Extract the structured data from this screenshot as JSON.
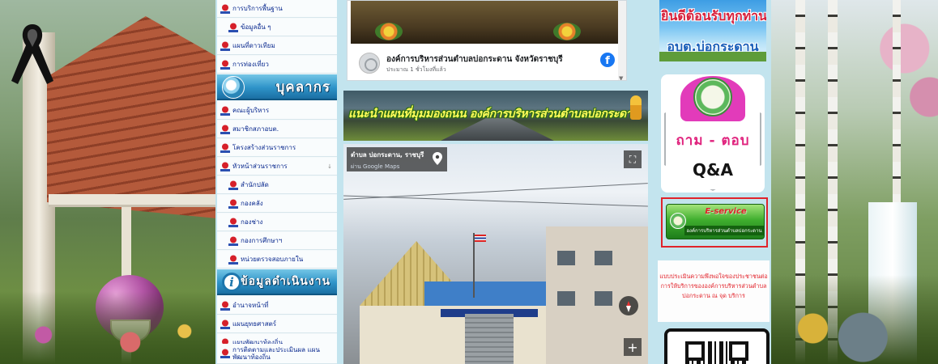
{
  "menu": {
    "items_top": [
      {
        "label": "การบริการพื้นฐาน"
      },
      {
        "label": "ข้อมูลอื่น ๆ"
      },
      {
        "label": "แผนที่ดาวเทียม"
      },
      {
        "label": "การท่องเที่ยว"
      }
    ],
    "header_personnel": "บุคลากร",
    "items_personnel": [
      {
        "label": "คณะผู้บริหาร"
      },
      {
        "label": "สมาชิกสภาอบต."
      },
      {
        "label": "โครงสร้างส่วนราชการ"
      },
      {
        "label": "หัวหน้าส่วนราชการ",
        "caret": "↓"
      }
    ],
    "items_departments": [
      {
        "label": "สำนักปลัด"
      },
      {
        "label": "กองคลัง"
      },
      {
        "label": "กองช่าง"
      },
      {
        "label": "กองการศึกษาฯ"
      },
      {
        "label": "หน่วยตรวจสอบภายใน"
      }
    ],
    "header_operations": "ข้อมูลดำเนินงาน",
    "header_operations_icon": "i",
    "items_operations": [
      {
        "label": "อำนาจหน้าที่"
      },
      {
        "label": "แผนยุทธศาสตร์"
      },
      {
        "label": "แผนพัฒนาท้องถิ่น"
      },
      {
        "label": "การติดตามและประเมินผล แผนพัฒนาท้องถิ่น"
      }
    ]
  },
  "facebook": {
    "page_name": "องค์การบริหารส่วนตำบลบ่อกระดาน จังหวัดราชบุรี",
    "post_time": "ประมาณ 1 ชั่วโมงที่แล้ว",
    "icon_letter": "f"
  },
  "banner": {
    "text": "แนะนำแผนที่มุมมองถนน องค์การบริหารส่วนตำบลบ่อกระดาน"
  },
  "map": {
    "location_title": "ตำบล บ่อกระดาน, ราชบุรี",
    "source": "ผ่าน Google Maps",
    "fullscreen_symbol": "⛶",
    "zoom_in_symbol": "+"
  },
  "right": {
    "welcome_line1": "ยินดีต้อนรับทุกท่าน",
    "welcome_line2": "อบต.บ่อกระดาน",
    "qa_ask": "ถาม - ตอบ",
    "qa_label": "Q&A",
    "eservice_title": "E-service",
    "eservice_subtitle": "องค์การบริหารส่วนตำบลบ่อกระดาน",
    "survey_text": "แบบประเมินความพึงพอใจของประชาชนต่อการให้บริการขององค์การบริหารส่วนตำบลบ่อกระดาน ณ จุด บริการ"
  },
  "colors": {
    "menu_text": "#0b2a8f",
    "header_blue": "#2e93c8",
    "accent_red": "#e0232b",
    "eservice_green": "#3fae2e",
    "facebook_blue": "#1877f2"
  }
}
